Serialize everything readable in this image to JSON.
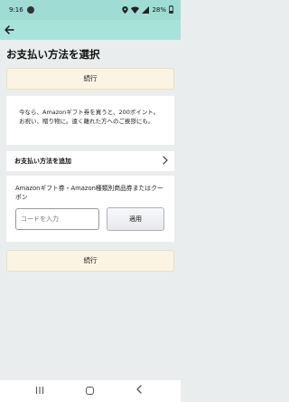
{
  "status": {
    "time": "9:16",
    "battery": "28%"
  },
  "header": {
    "title": "お支払い方法を選択"
  },
  "buttons": {
    "continue_top": "続行",
    "continue_bottom": "続行"
  },
  "promo": {
    "text": "今なら、Amazonギフト券を買うと、200ポイント。お祝い、贈り物に。遠く離れた方へのご挨拶にも。"
  },
  "payment": {
    "add_label": "お支払い方法を追加"
  },
  "coupon": {
    "heading": "Amazonギフト券・Amazon種類別商品券またはクーポン",
    "placeholder": "コードを入力",
    "apply_label": "適用"
  },
  "icons": {
    "back": "back-arrow-icon",
    "chevron": "chevron-right-icon",
    "location": "location-icon",
    "wifi": "wifi-icon",
    "signal": "signal-icon",
    "battery": "battery-icon",
    "notification": "notification-icon"
  }
}
